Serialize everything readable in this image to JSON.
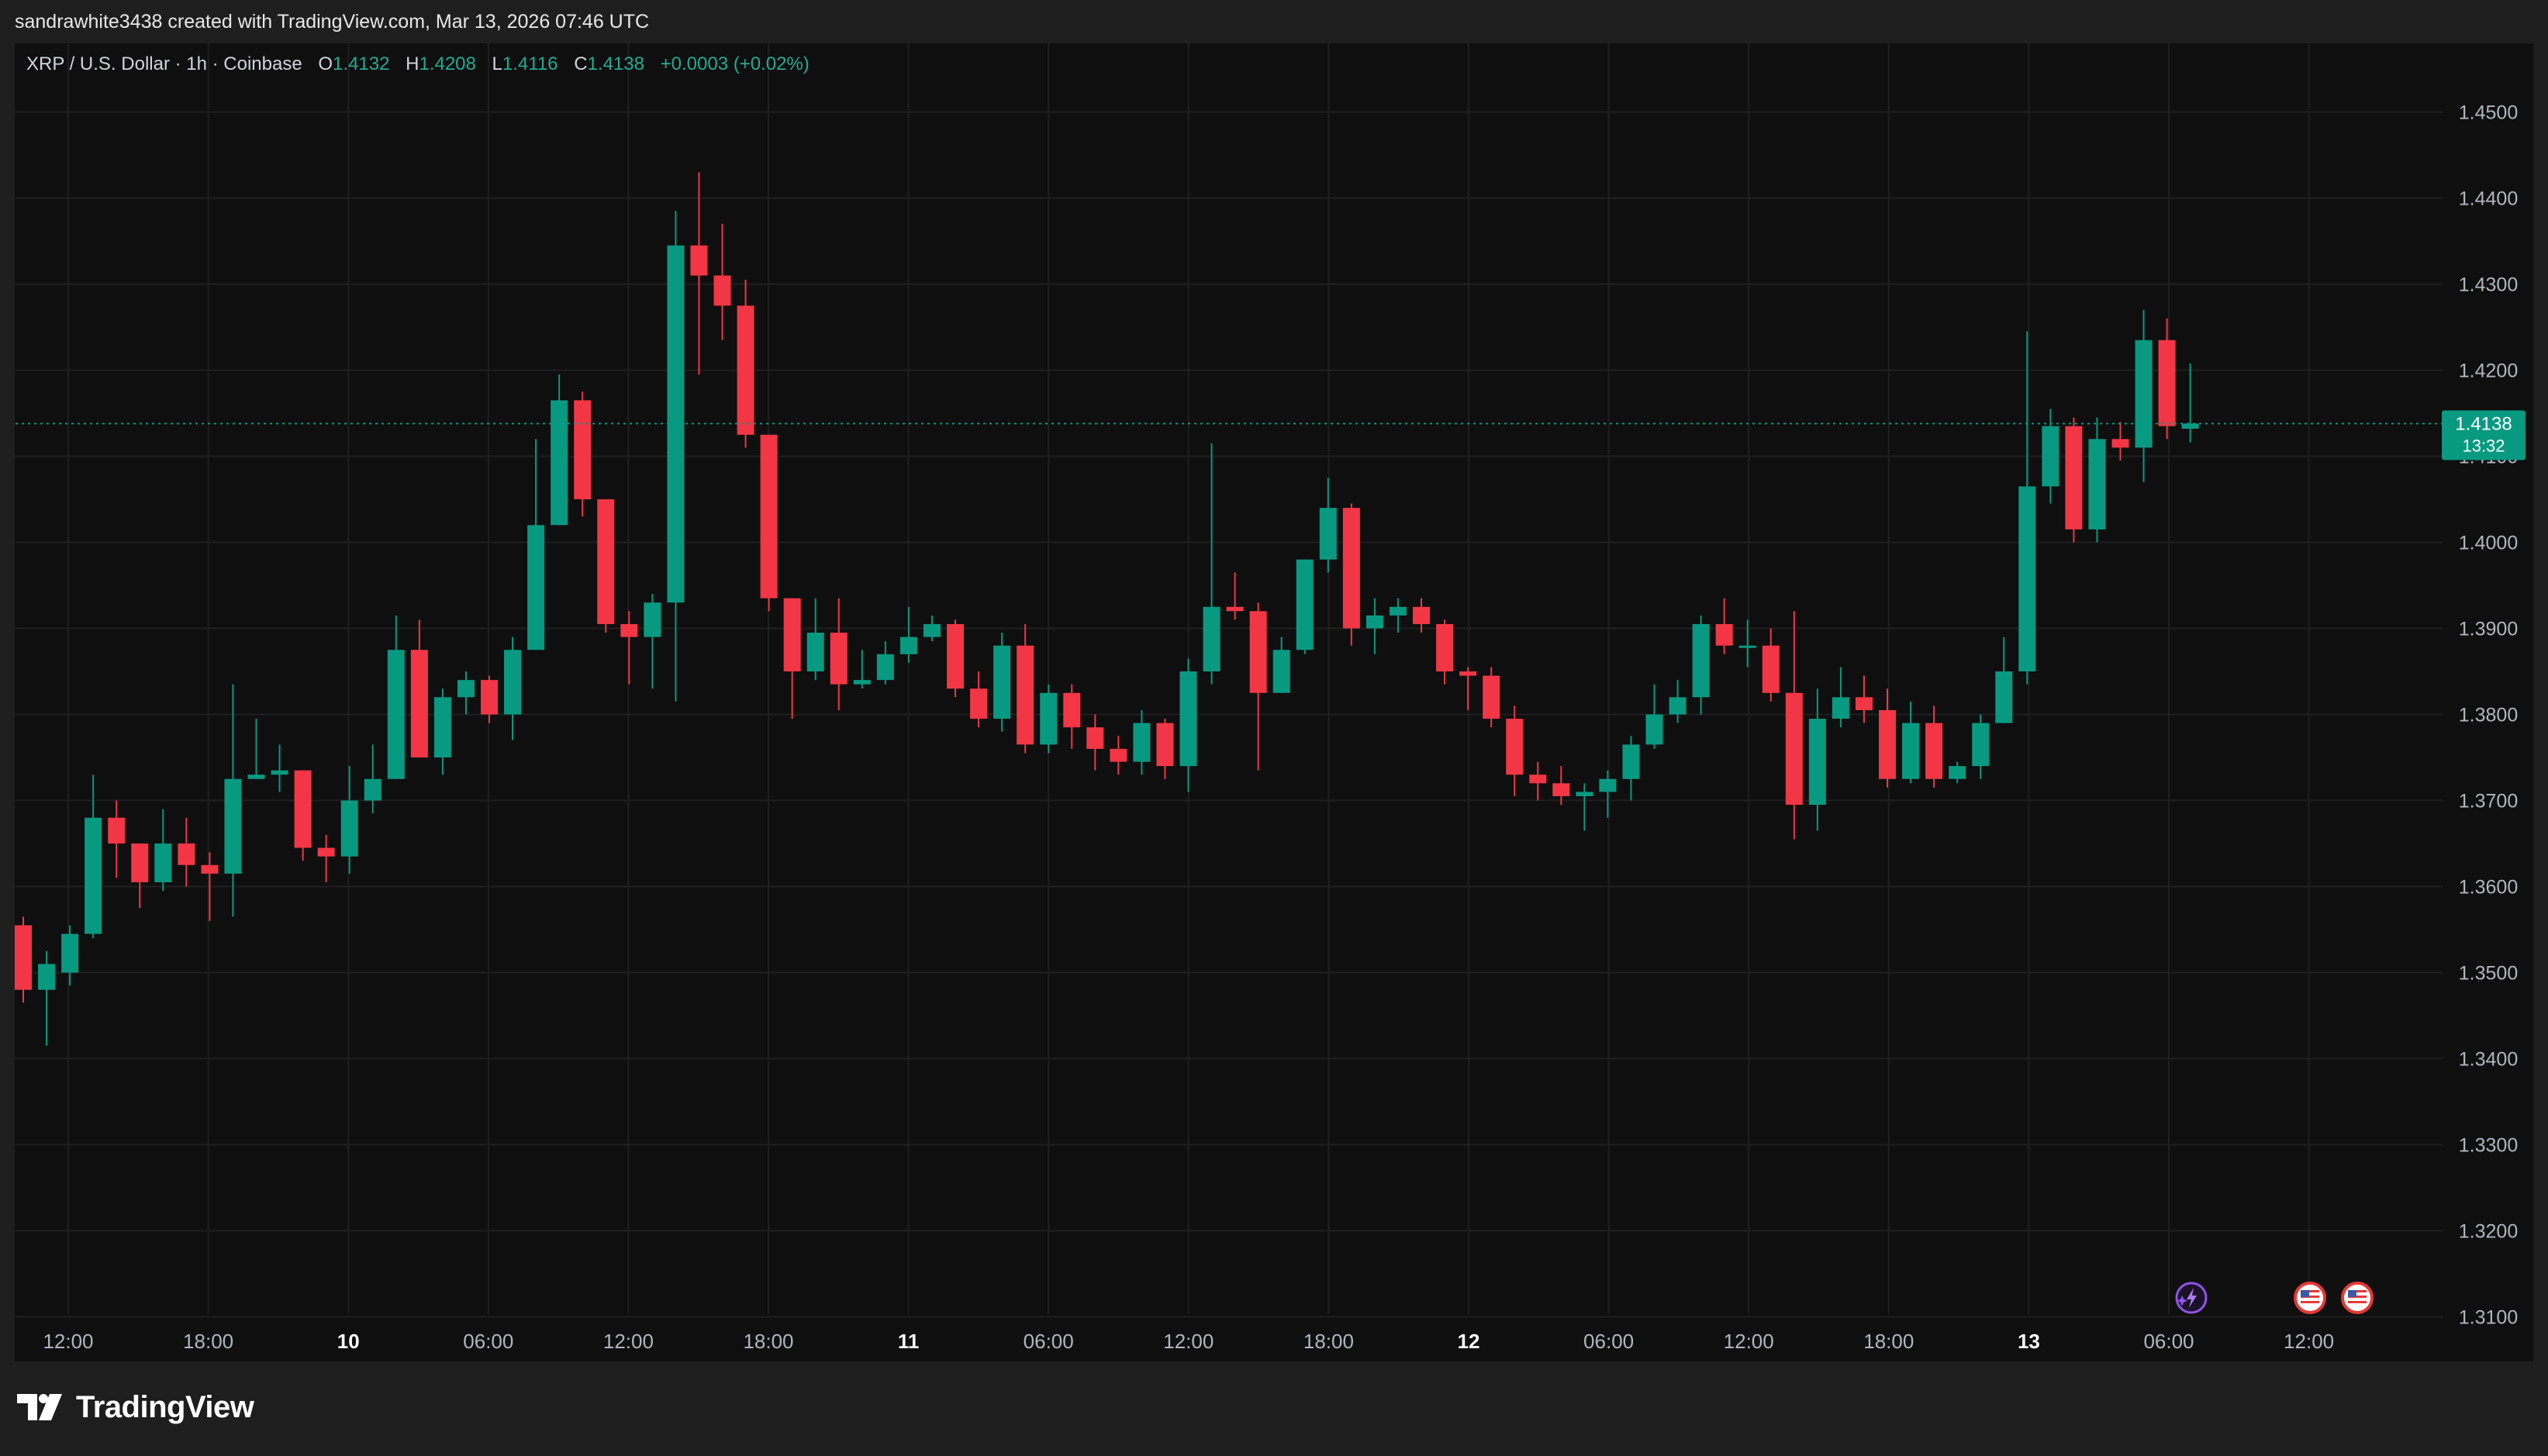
{
  "header": {
    "attribution": "sandrawhite3438 created with TradingView.com, Mar 13, 2026 07:46 UTC"
  },
  "legend": {
    "symbol": "XRP / U.S. Dollar · 1h · Coinbase",
    "open_label": "O",
    "open": "1.4132",
    "high_label": "H",
    "high": "1.4208",
    "low_label": "L",
    "low": "1.4116",
    "close_label": "C",
    "close": "1.4138",
    "change": "+0.0003 (+0.02%)"
  },
  "price_tag": {
    "price": "1.4138",
    "countdown": "13:32"
  },
  "footer": {
    "brand": "TradingView"
  },
  "colors": {
    "up": "#089981",
    "down": "#f23645",
    "background": "#0f0f0f",
    "grid": "#1f1f1f",
    "price_line": "#089981"
  },
  "icons": [
    "tradingview-logo-icon",
    "lightning-event-icon",
    "us-flag-event-icon",
    "us-flag-event-icon"
  ],
  "chart_data": {
    "type": "candlestick",
    "title": "XRP / U.S. Dollar · 1h · Coinbase",
    "timeframe": "1h",
    "y_ticks": [
      "1.4500",
      "1.4400",
      "1.4300",
      "1.4200",
      "1.4100",
      "1.4000",
      "1.3900",
      "1.3800",
      "1.3700",
      "1.3600",
      "1.3500",
      "1.3400",
      "1.3300",
      "1.3200",
      "1.3100"
    ],
    "ylim": [
      1.31,
      1.45
    ],
    "x_ticks": [
      {
        "label": "12:00",
        "bold": false
      },
      {
        "label": "18:00",
        "bold": false
      },
      {
        "label": "10",
        "bold": true
      },
      {
        "label": "06:00",
        "bold": false
      },
      {
        "label": "12:00",
        "bold": false
      },
      {
        "label": "18:00",
        "bold": false
      },
      {
        "label": "11",
        "bold": true
      },
      {
        "label": "06:00",
        "bold": false
      },
      {
        "label": "12:00",
        "bold": false
      },
      {
        "label": "18:00",
        "bold": false
      },
      {
        "label": "12",
        "bold": true
      },
      {
        "label": "06:00",
        "bold": false
      },
      {
        "label": "12:00",
        "bold": false
      },
      {
        "label": "18:00",
        "bold": false
      },
      {
        "label": "13",
        "bold": true
      },
      {
        "label": "06:00",
        "bold": false
      },
      {
        "label": "12:00",
        "bold": false
      }
    ],
    "grid": true,
    "last_price": 1.4138,
    "candles": [
      [
        1.3555,
        1.348,
        1.3565,
        1.3465
      ],
      [
        1.348,
        1.351,
        1.3525,
        1.3415
      ],
      [
        1.35,
        1.3545,
        1.3555,
        1.3485
      ],
      [
        1.3545,
        1.368,
        1.373,
        1.354
      ],
      [
        1.368,
        1.365,
        1.37,
        1.361
      ],
      [
        1.365,
        1.3605,
        1.365,
        1.3575
      ],
      [
        1.3605,
        1.365,
        1.369,
        1.3595
      ],
      [
        1.365,
        1.3625,
        1.368,
        1.36
      ],
      [
        1.3625,
        1.3615,
        1.364,
        1.356
      ],
      [
        1.3615,
        1.3725,
        1.3835,
        1.3565
      ],
      [
        1.3725,
        1.373,
        1.3795,
        1.3725
      ],
      [
        1.373,
        1.3735,
        1.3765,
        1.371
      ],
      [
        1.3735,
        1.3645,
        1.3735,
        1.363
      ],
      [
        1.3645,
        1.3635,
        1.366,
        1.3605
      ],
      [
        1.3635,
        1.37,
        1.374,
        1.3615
      ],
      [
        1.37,
        1.3725,
        1.3765,
        1.3685
      ],
      [
        1.3725,
        1.3875,
        1.3915,
        1.3725
      ],
      [
        1.3875,
        1.375,
        1.391,
        1.375
      ],
      [
        1.375,
        1.382,
        1.383,
        1.373
      ],
      [
        1.382,
        1.384,
        1.385,
        1.38
      ],
      [
        1.384,
        1.38,
        1.3845,
        1.379
      ],
      [
        1.38,
        1.3875,
        1.389,
        1.377
      ],
      [
        1.3875,
        1.402,
        1.412,
        1.3875
      ],
      [
        1.402,
        1.4165,
        1.4195,
        1.402
      ],
      [
        1.4165,
        1.405,
        1.4175,
        1.403
      ],
      [
        1.405,
        1.3905,
        1.405,
        1.3895
      ],
      [
        1.3905,
        1.389,
        1.392,
        1.3835
      ],
      [
        1.389,
        1.393,
        1.394,
        1.383
      ],
      [
        1.393,
        1.4345,
        1.4385,
        1.3815
      ],
      [
        1.4345,
        1.431,
        1.443,
        1.4195
      ],
      [
        1.431,
        1.4275,
        1.437,
        1.4235
      ],
      [
        1.4275,
        1.4125,
        1.4305,
        1.411
      ],
      [
        1.4125,
        1.3935,
        1.4125,
        1.392
      ],
      [
        1.3935,
        1.385,
        1.3935,
        1.3795
      ],
      [
        1.385,
        1.3895,
        1.3935,
        1.384
      ],
      [
        1.3895,
        1.3835,
        1.3935,
        1.3805
      ],
      [
        1.3835,
        1.384,
        1.3875,
        1.383
      ],
      [
        1.384,
        1.387,
        1.3885,
        1.3835
      ],
      [
        1.387,
        1.389,
        1.3925,
        1.386
      ],
      [
        1.389,
        1.3905,
        1.3915,
        1.3885
      ],
      [
        1.3905,
        1.383,
        1.391,
        1.382
      ],
      [
        1.383,
        1.3795,
        1.385,
        1.3785
      ],
      [
        1.3795,
        1.388,
        1.3895,
        1.378
      ],
      [
        1.388,
        1.3765,
        1.3905,
        1.3755
      ],
      [
        1.3765,
        1.3825,
        1.3835,
        1.3755
      ],
      [
        1.3825,
        1.3785,
        1.3835,
        1.376
      ],
      [
        1.3785,
        1.376,
        1.38,
        1.3735
      ],
      [
        1.376,
        1.3745,
        1.3775,
        1.373
      ],
      [
        1.3745,
        1.379,
        1.3805,
        1.373
      ],
      [
        1.379,
        1.374,
        1.3795,
        1.3725
      ],
      [
        1.374,
        1.385,
        1.3865,
        1.371
      ],
      [
        1.385,
        1.3925,
        1.4115,
        1.3835
      ],
      [
        1.3925,
        1.392,
        1.3965,
        1.391
      ],
      [
        1.392,
        1.3825,
        1.393,
        1.3735
      ],
      [
        1.3825,
        1.3875,
        1.389,
        1.3825
      ],
      [
        1.3875,
        1.398,
        1.398,
        1.387
      ],
      [
        1.398,
        1.404,
        1.4075,
        1.3965
      ],
      [
        1.404,
        1.39,
        1.4045,
        1.388
      ],
      [
        1.39,
        1.3915,
        1.3935,
        1.387
      ],
      [
        1.3915,
        1.3925,
        1.3935,
        1.3895
      ],
      [
        1.3925,
        1.3905,
        1.3935,
        1.3895
      ],
      [
        1.3905,
        1.385,
        1.391,
        1.3835
      ],
      [
        1.385,
        1.3845,
        1.3855,
        1.3805
      ],
      [
        1.3845,
        1.3795,
        1.3855,
        1.3785
      ],
      [
        1.3795,
        1.373,
        1.381,
        1.3705
      ],
      [
        1.373,
        1.372,
        1.3745,
        1.37
      ],
      [
        1.372,
        1.3705,
        1.374,
        1.3695
      ],
      [
        1.3705,
        1.371,
        1.372,
        1.3665
      ],
      [
        1.371,
        1.3725,
        1.3735,
        1.368
      ],
      [
        1.3725,
        1.3765,
        1.3775,
        1.37
      ],
      [
        1.3765,
        1.38,
        1.3835,
        1.376
      ],
      [
        1.38,
        1.382,
        1.384,
        1.379
      ],
      [
        1.382,
        1.3905,
        1.3915,
        1.38
      ],
      [
        1.3905,
        1.388,
        1.3935,
        1.387
      ],
      [
        1.388,
        1.388,
        1.391,
        1.3855
      ],
      [
        1.388,
        1.3825,
        1.39,
        1.3815
      ],
      [
        1.3825,
        1.3695,
        1.392,
        1.3655
      ],
      [
        1.3695,
        1.3795,
        1.383,
        1.3665
      ],
      [
        1.3795,
        1.382,
        1.3855,
        1.3785
      ],
      [
        1.382,
        1.3805,
        1.3845,
        1.379
      ],
      [
        1.3805,
        1.3725,
        1.383,
        1.3715
      ],
      [
        1.3725,
        1.379,
        1.3815,
        1.372
      ],
      [
        1.379,
        1.3725,
        1.381,
        1.3715
      ],
      [
        1.3725,
        1.374,
        1.3745,
        1.372
      ],
      [
        1.374,
        1.379,
        1.38,
        1.3725
      ],
      [
        1.379,
        1.385,
        1.389,
        1.379
      ],
      [
        1.385,
        1.4065,
        1.4245,
        1.3835
      ],
      [
        1.4065,
        1.4135,
        1.4155,
        1.4045
      ],
      [
        1.4135,
        1.4015,
        1.4145,
        1.4
      ],
      [
        1.4015,
        1.412,
        1.4145,
        1.4
      ],
      [
        1.412,
        1.411,
        1.414,
        1.4095
      ],
      [
        1.411,
        1.4235,
        1.427,
        1.407
      ],
      [
        1.4235,
        1.4135,
        1.426,
        1.412
      ],
      [
        1.4132,
        1.4138,
        1.4208,
        1.4116
      ]
    ]
  }
}
